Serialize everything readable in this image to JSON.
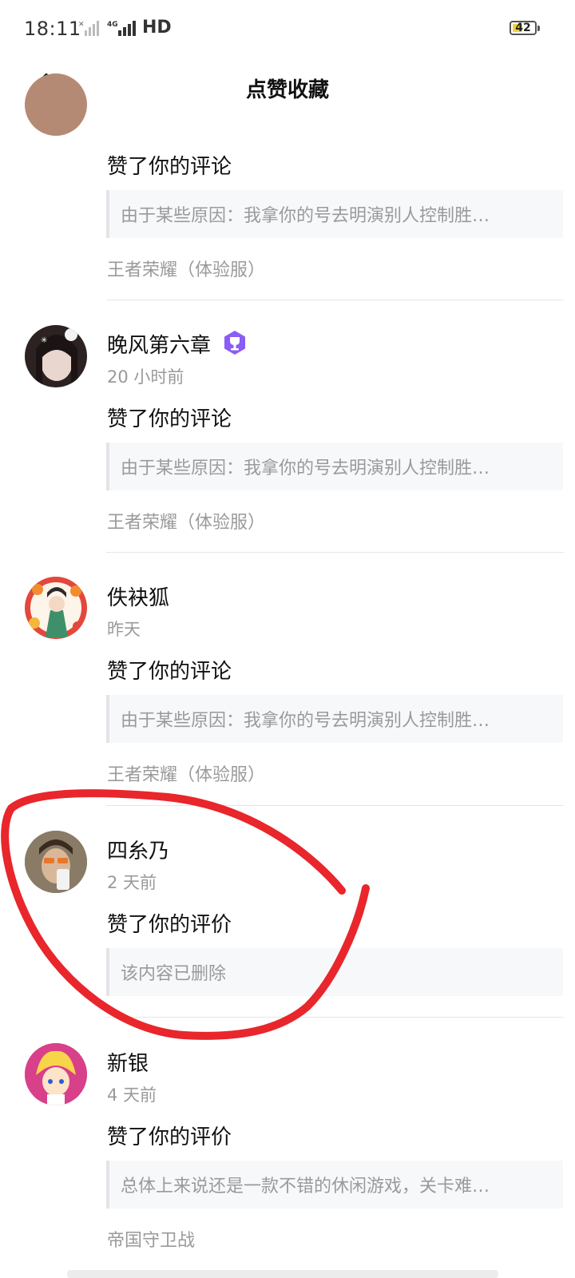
{
  "status_bar": {
    "time": "18:11",
    "network": "HD",
    "battery": "42"
  },
  "nav": {
    "title": "点赞收藏",
    "back_icon": "chevron-left-icon"
  },
  "notifications": [
    {
      "name": "",
      "time": "",
      "action": "赞了你的评论",
      "quote": "由于某些原因：我拿你的号去明演别人控制胜…",
      "source": "王者荣耀（体验服）"
    },
    {
      "name": "晚风第六章",
      "time": "20 小时前",
      "action": "赞了你的评论",
      "quote": "由于某些原因：我拿你的号去明演别人控制胜…",
      "source": "王者荣耀（体验服）",
      "badge_icon": "trophy-badge-icon",
      "badge_color": "#8b5cf6"
    },
    {
      "name": "佚袂狐",
      "time": "昨天",
      "action": "赞了你的评论",
      "quote": "由于某些原因：我拿你的号去明演别人控制胜…",
      "source": "王者荣耀（体验服）"
    },
    {
      "name": "四糸乃",
      "time": "2 天前",
      "action": "赞了你的评价",
      "quote": "该内容已删除",
      "source": ""
    },
    {
      "name": "新银",
      "time": "4 天前",
      "action": "赞了你的评价",
      "quote": "总体上来说还是一款不错的休闲游戏，关卡难…",
      "source": "帝国守卫战"
    }
  ],
  "colors": {
    "annotation_red": "#e8262b",
    "secondary_text": "#9a9a9a"
  }
}
